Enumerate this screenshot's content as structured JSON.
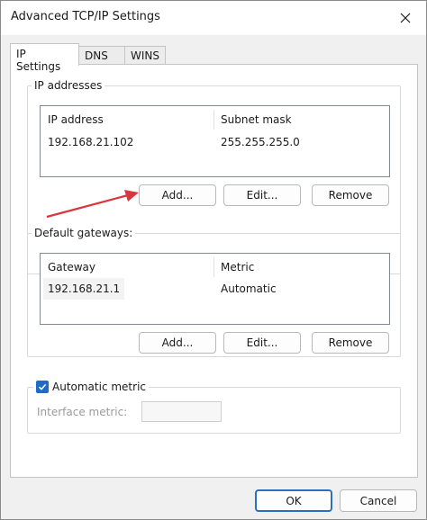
{
  "window": {
    "title": "Advanced TCP/IP Settings"
  },
  "tabs": [
    {
      "label": "IP Settings",
      "active": true
    },
    {
      "label": "DNS",
      "active": false
    },
    {
      "label": "WINS",
      "active": false
    }
  ],
  "ip_addresses": {
    "group_label": "IP addresses",
    "columns": [
      "IP address",
      "Subnet mask"
    ],
    "rows": [
      {
        "ip": "192.168.21.102",
        "mask": "255.255.255.0"
      }
    ],
    "buttons": {
      "add": "Add...",
      "edit": "Edit...",
      "remove": "Remove"
    }
  },
  "default_gateways": {
    "group_label": "Default gateways:",
    "columns": [
      "Gateway",
      "Metric"
    ],
    "rows": [
      {
        "gateway": "192.168.21.1",
        "metric": "Automatic"
      }
    ],
    "buttons": {
      "add": "Add...",
      "edit": "Edit...",
      "remove": "Remove"
    }
  },
  "automatic_metric": {
    "label": "Automatic metric",
    "checked": true,
    "interface_metric_label": "Interface metric:",
    "interface_metric_value": ""
  },
  "footer": {
    "ok": "OK",
    "cancel": "Cancel"
  },
  "colors": {
    "accent": "#1f6bc6",
    "arrow": "#d9363e"
  },
  "icons": {
    "close": "close-icon",
    "check": "checkmark-icon",
    "arrow": "red-arrow-annotation"
  }
}
